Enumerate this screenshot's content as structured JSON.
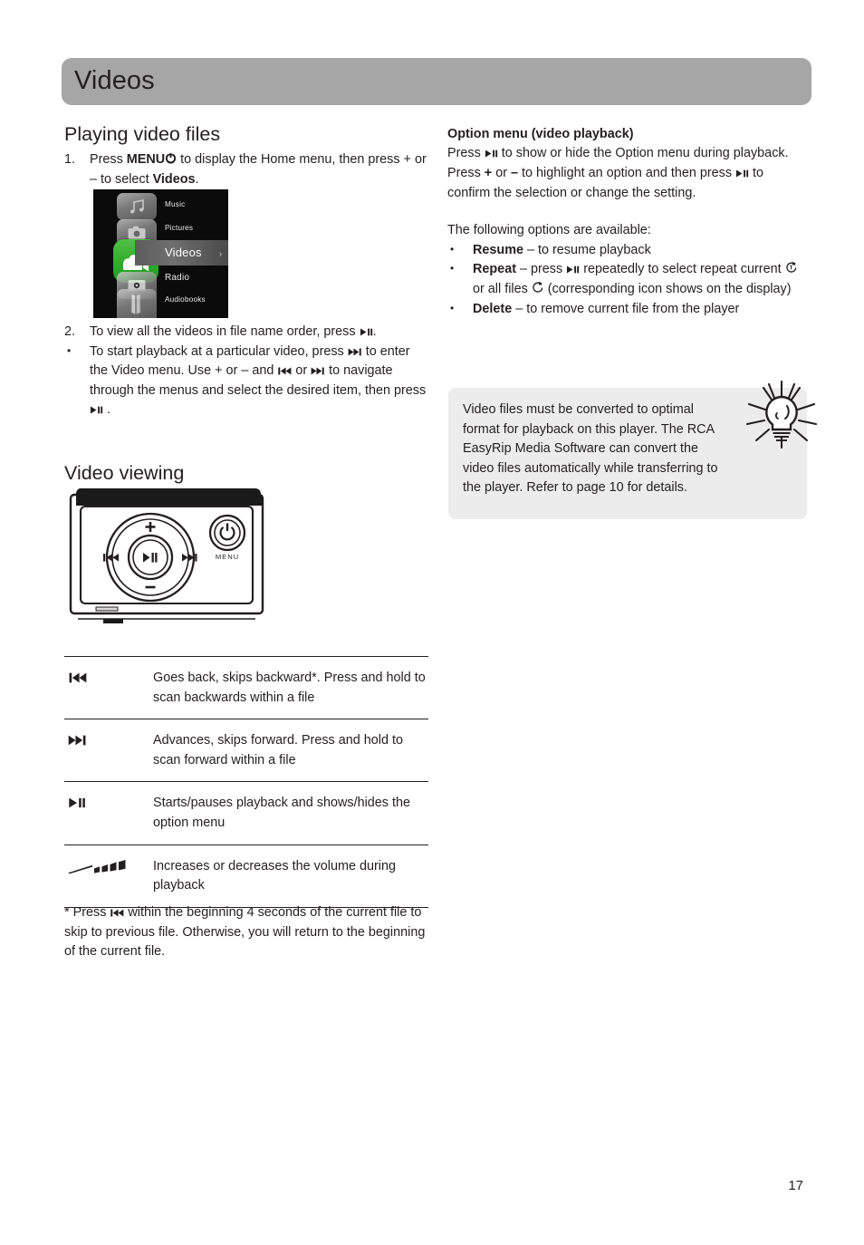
{
  "banner": {
    "title": "Videos"
  },
  "left": {
    "section_heading": "Playing video files",
    "step1": {
      "marker": "1.",
      "part1": "Press ",
      "bold1": "MENU",
      "icon1": "power-icon",
      "part2": " to display the Home menu, then press + or – to select ",
      "bold2": "Videos",
      "part3": "."
    },
    "step2": {
      "marker": "2.",
      "part1": "To view all the videos in file name order, press ",
      "icon1": "play-pause-icon",
      "part2": "."
    },
    "bullet1": {
      "marker": "•",
      "part1": "To start playback at a particular video, press ",
      "icon1": "next-track-icon",
      "part2": " to enter the Video menu. Use + or – and ",
      "icon2": "prev-track-icon",
      "part3": " or ",
      "icon3": "next-track-icon",
      "part4": " to navigate through the menus and select the desired item, then press ",
      "icon4": "play-pause-icon",
      "part5": " ."
    },
    "menu_screenshot": {
      "items": [
        "Music",
        "Pictures",
        "Videos",
        "Radio",
        "Audiobooks"
      ],
      "selected": "Videos",
      "chevron": "›",
      "selected_color": "#2faf2a",
      "background_color": "#0b0b0b"
    },
    "video_viewing_heading": "Video viewing",
    "device": {
      "menu_label": "MENU",
      "plus": "+",
      "minus": "–"
    },
    "button_table": [
      {
        "icon": "prev-track-icon",
        "description": "Goes back, skips backward*. Press and hold to scan backwards within a file"
      },
      {
        "icon": "next-track-icon",
        "description": "Advances, skips forward. Press and hold to scan forward within a file"
      },
      {
        "icon": "play-pause-icon",
        "description": "Starts/pauses playback and shows/hides the option menu"
      },
      {
        "icon": "volume-icon",
        "description": "Increases or decreases the volume during playback"
      }
    ],
    "footnote": {
      "part1": "* Press ",
      "icon1": "prev-track-icon",
      "part2": " within the beginning 4 seconds of the current file to skip to previous file. Otherwise, you will return to the beginning of the current file."
    }
  },
  "right": {
    "sub_heading": "Option menu (video playback)",
    "intro": {
      "part1": "Press ",
      "icon1": "play-pause-icon",
      "part2": " to show or hide the Option menu during playback. Press ",
      "bold1": "+",
      "part3": " or ",
      "bold2": "–",
      "part4": " to highlight an option and then press ",
      "icon2": "play-pause-icon",
      "part5": " to confirm the selection or change the setting."
    },
    "options_lead": "The following options are available:",
    "options": [
      {
        "marker": "•",
        "label": "Resume",
        "part1": " – to resume playback"
      },
      {
        "marker": "•",
        "label": "Repeat",
        "part1": " – press ",
        "icon1": "play-pause-icon",
        "part2": " repeatedly to select repeat current ",
        "icon2": "repeat-one-icon",
        "part3": " or all files ",
        "icon3": "repeat-all-icon",
        "part4": " (corresponding icon shows on the display)"
      },
      {
        "marker": "•",
        "label": "Delete",
        "part1": " – to remove current file from the player"
      }
    ],
    "note": {
      "icon": "lightbulb-icon",
      "text": "Video files must be converted to optimal format for playback on this player. The RCA EasyRip Media Software can convert the video files automatically while transferring to the player. Refer to page 10 for details."
    }
  },
  "footer": {
    "page_number": "17"
  }
}
